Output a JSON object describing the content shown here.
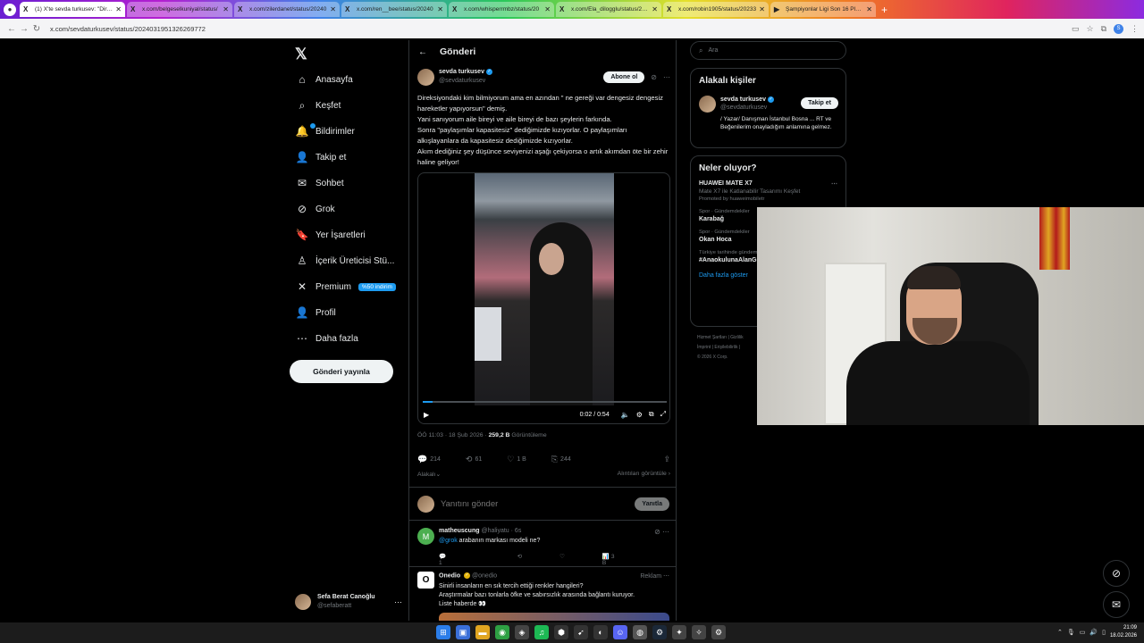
{
  "browser": {
    "tabs": [
      {
        "title": "(1) X'te sevda turkusev: \"Direks",
        "favicon": "X",
        "active": true
      },
      {
        "title": "x.com/belgeselkuniyal/status/",
        "favicon": "X",
        "active": false
      },
      {
        "title": "x.com/zilerdanet/status/20240",
        "favicon": "X",
        "active": false
      },
      {
        "title": "x.com/ren__bee/status/20240",
        "favicon": "X",
        "active": false
      },
      {
        "title": "x.com/whisperrmbz/status/20",
        "favicon": "X",
        "active": false
      },
      {
        "title": "x.com/Ela_dilogglu/status/2024",
        "favicon": "X",
        "active": false
      },
      {
        "title": "x.com/robin1905/status/20233",
        "favicon": "X",
        "active": false
      },
      {
        "title": "Şampiyonlar Ligi Son 16 Play-O",
        "favicon": "▶",
        "active": false
      }
    ],
    "new_tab": "+",
    "url": "x.com/sevdaturkusev/status/2024031951326269772"
  },
  "nav": {
    "items": [
      {
        "label": "Anasayfa",
        "icon": "home-icon",
        "glyph": "⌂"
      },
      {
        "label": "Keşfet",
        "icon": "search-icon",
        "glyph": "⌕"
      },
      {
        "label": "Bildirimler",
        "icon": "bell-icon",
        "glyph": "🔔"
      },
      {
        "label": "Takip et",
        "icon": "follow-icon",
        "glyph": "👤"
      },
      {
        "label": "Sohbet",
        "icon": "mail-icon",
        "glyph": "✉"
      },
      {
        "label": "Grok",
        "icon": "grok-icon",
        "glyph": "⊘"
      },
      {
        "label": "Yer İşaretleri",
        "icon": "bookmark-icon",
        "glyph": "🔖"
      },
      {
        "label": "İçerik Üreticisi Stü...",
        "icon": "creator-icon",
        "glyph": "♙"
      },
      {
        "label": "Premium",
        "icon": "x-icon",
        "glyph": "✕"
      },
      {
        "label": "Profil",
        "icon": "profile-icon",
        "glyph": "👤"
      },
      {
        "label": "Daha fazla",
        "icon": "more-circle-icon",
        "glyph": "⋯"
      }
    ],
    "premium_badge": "%50 indirim",
    "post_button": "Gönderi yayınla",
    "account": {
      "name": "Sefa Berat Canoğlu",
      "handle": "@sefaberatt"
    }
  },
  "post": {
    "header": "Gönderi",
    "author": {
      "name": "sevda turkusev",
      "handle": "@sevdaturkusev"
    },
    "follow_label": "Abone ol",
    "text": [
      "Direksiyondaki kim bilmiyorum ama en azından \" ne gereği var dengesiz dengesiz hareketler yapıyorsun\" demiş.",
      "Yani sanıyorum aile bireyi ve aile bireyi de bazı şeylerin farkında.",
      "Sonra \"paylaşımlar kapasitesiz\" dediğimizde kızıyorlar. O paylaşımları alkışlayanlara da kapasitesiz dediğimizde kızıyorlar.",
      "Akım dediğiniz şey düşünce seviyenizi aşağı çekiyorsa o artık akımdan öte bir zehir haline geliyor!"
    ],
    "video": {
      "time": "0:02 / 0:54",
      "progress": 0.04
    },
    "timestamp": "ÖÖ 11:03 · 18 Şub 2026 ·",
    "views": "259,2 B",
    "views_label": "Görüntüleme",
    "stats": {
      "replies": "214",
      "reposts": "61",
      "likes": "1 B",
      "bookmarks": "244"
    },
    "related_label": "Alakalı",
    "quotes_label": "Alıntıları görüntüle"
  },
  "reply": {
    "placeholder": "Yanıtını gönder",
    "button": "Yanıtla"
  },
  "replies": [
    {
      "name": "matheuscung",
      "handle": "@haliyatu · 6s",
      "mention": "@grok",
      "text": " arabanın markası modeli ne?",
      "replies": "1",
      "views": "3 B",
      "avatar_letter": "M"
    }
  ],
  "ad": {
    "name": "Onedio",
    "handle": "@onedio",
    "label": "Reklam",
    "lines": [
      "Sinirli insanların en sık tercih ettiği renkler hangileri?",
      "Araştırmalar bazı tonlarla öfke ve sabırsızlık arasında bağlantı kuruyor.",
      "Liste haberde 👀"
    ]
  },
  "right": {
    "search_placeholder": "Ara",
    "related_title": "Alakalı kişiler",
    "related_person": {
      "name": "sevda turkusev",
      "handle": "@sevdaturkusev",
      "follow": "Takip et",
      "bio": "/ Yazar/ Danışman İstanbul Bosna ... RT ve Beğenilerim onayladığım anlamına gelmez."
    },
    "trends_title": "Neler oluyor?",
    "trends": [
      {
        "category": "",
        "name": "HUAWEI MATE X7",
        "sub": "Mate X7 ile Katlanabilir Tasarımı Keşfet",
        "promo": "Promoted by huaweimobiletr"
      },
      {
        "category": "Spor · Gündemdekiler",
        "name": "Karabağ",
        "sub": "",
        "promo": ""
      },
      {
        "category": "Spor · Gündemdekiler",
        "name": "Okan Hoca",
        "sub": "",
        "promo": ""
      },
      {
        "category": "Türkiye tarihinde gündemde",
        "name": "#AnaokulunaAlanG",
        "sub": "",
        "promo": ""
      }
    ],
    "show_more": "Daha fazla göster",
    "footer": [
      "Hizmet Şartları | Gizlilik",
      "İmprint | Erişilebilirlik |",
      "© 2026 X Corp."
    ]
  },
  "taskbar": {
    "time": "21:09",
    "date": "18.02.2026"
  },
  "colors": {
    "accent": "#1d9bf0",
    "background": "#000000",
    "border": "#2f3336",
    "muted": "#71767b"
  }
}
